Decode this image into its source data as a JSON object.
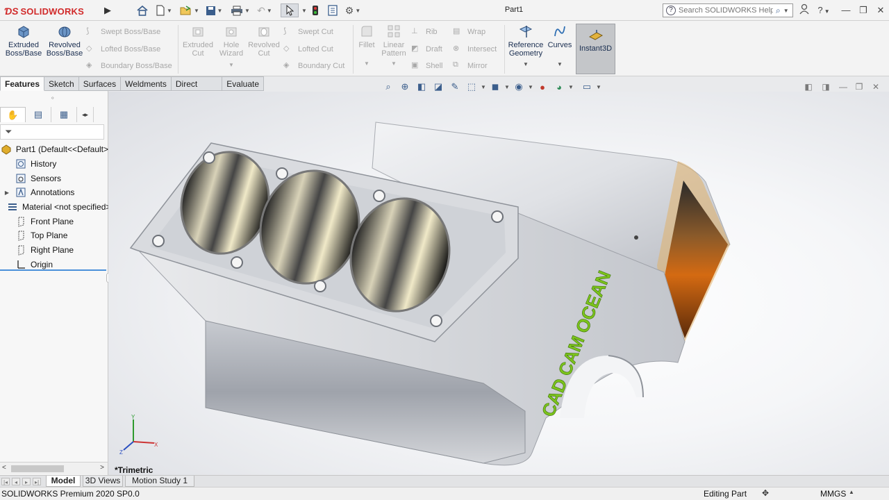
{
  "app": {
    "brand": "SOLIDWORKS",
    "document_title": "Part1"
  },
  "search": {
    "placeholder": "Search SOLIDWORKS Help"
  },
  "command_manager": {
    "extruded_boss": "Extruded\nBoss/Base",
    "revolved_boss": "Revolved\nBoss/Base",
    "swept_boss": "Swept Boss/Base",
    "lofted_boss": "Lofted Boss/Base",
    "boundary_boss": "Boundary Boss/Base",
    "extruded_cut": "Extruded\nCut",
    "hole_wizard": "Hole\nWizard",
    "revolved_cut": "Revolved\nCut",
    "swept_cut": "Swept Cut",
    "lofted_cut": "Lofted Cut",
    "boundary_cut": "Boundary Cut",
    "fillet": "Fillet",
    "linear_pattern": "Linear\nPattern",
    "rib": "Rib",
    "draft": "Draft",
    "shell": "Shell",
    "wrap": "Wrap",
    "intersect": "Intersect",
    "mirror": "Mirror",
    "reference_geometry": "Reference\nGeometry",
    "curves": "Curves",
    "instant3d": "Instant3D"
  },
  "tabs": [
    {
      "label": "Features",
      "active": true
    },
    {
      "label": "Sketch",
      "active": false
    },
    {
      "label": "Surfaces",
      "active": false
    },
    {
      "label": "Weldments",
      "active": false
    },
    {
      "label": "Direct Editing",
      "active": false
    },
    {
      "label": "Evaluate",
      "active": false
    }
  ],
  "feature_tree": {
    "root": "Part1  (Default<<Default>",
    "items": [
      {
        "label": "History",
        "icon": "history-folder-icon",
        "expandable": false
      },
      {
        "label": "Sensors",
        "icon": "sensors-icon",
        "expandable": false
      },
      {
        "label": "Annotations",
        "icon": "annotations-icon",
        "expandable": true
      },
      {
        "label": "Material <not specified>",
        "icon": "material-icon",
        "expandable": false
      },
      {
        "label": "Front Plane",
        "icon": "plane-icon",
        "expandable": false
      },
      {
        "label": "Top Plane",
        "icon": "plane-icon",
        "expandable": false
      },
      {
        "label": "Right Plane",
        "icon": "plane-icon",
        "expandable": false
      },
      {
        "label": "Origin",
        "icon": "origin-icon",
        "expandable": false
      }
    ]
  },
  "viewport": {
    "view_orientation": "*Trimetric",
    "model_text": "CAD CAM OCEAN",
    "triad": {
      "x": "X",
      "y": "Y",
      "z": "Z"
    }
  },
  "bottom_tabs": [
    {
      "label": "Model",
      "active": true
    },
    {
      "label": "3D Views",
      "active": false
    },
    {
      "label": "Motion Study 1",
      "active": false
    }
  ],
  "status_bar": {
    "version": "SOLIDWORKS Premium 2020 SP0.0",
    "mode": "Editing Part",
    "units": "MMGS"
  },
  "colors": {
    "brand_red": "#d12a2a",
    "icon_blue": "#3b5e8c",
    "model_silver": "#c9ccd2",
    "model_text_green": "#7cc41c",
    "selection_blue": "#4a90d9"
  }
}
